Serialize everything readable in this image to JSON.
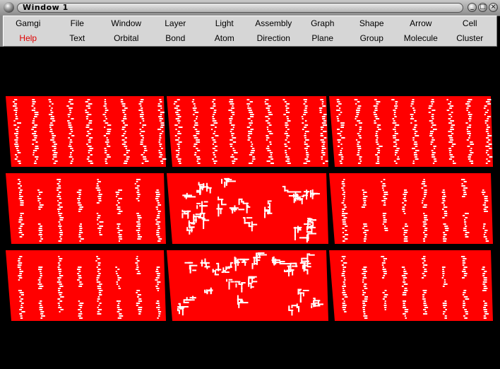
{
  "window": {
    "title": "Window 1",
    "buttons": [
      {
        "name": "minimize",
        "glyph": "_"
      },
      {
        "name": "maximize",
        "glyph": "□"
      },
      {
        "name": "close",
        "glyph": "×"
      }
    ]
  },
  "menu": {
    "row1": [
      "Gamgi",
      "File",
      "Window",
      "Layer",
      "Light",
      "Assembly",
      "Graph",
      "Shape",
      "Arrow",
      "Cell"
    ],
    "row2": [
      "Help",
      "Text",
      "Orbital",
      "Bond",
      "Atom",
      "Direction",
      "Plane",
      "Group",
      "Molecule",
      "Cluster"
    ],
    "highlight_color": "#e00000"
  },
  "viewport": {
    "background": "#000000",
    "panel_color": "#ff0000",
    "pattern_color": "#ffffff",
    "panels": [
      {
        "row": 0,
        "col": 0,
        "pattern": "stripes"
      },
      {
        "row": 0,
        "col": 1,
        "pattern": "stripes"
      },
      {
        "row": 0,
        "col": 2,
        "pattern": "stripes"
      },
      {
        "row": 1,
        "col": 0,
        "pattern": "streaks"
      },
      {
        "row": 1,
        "col": 1,
        "pattern": "dendrites"
      },
      {
        "row": 1,
        "col": 2,
        "pattern": "streaks"
      },
      {
        "row": 2,
        "col": 0,
        "pattern": "streaks"
      },
      {
        "row": 2,
        "col": 1,
        "pattern": "dendrites"
      },
      {
        "row": 2,
        "col": 2,
        "pattern": "streaks"
      }
    ]
  }
}
